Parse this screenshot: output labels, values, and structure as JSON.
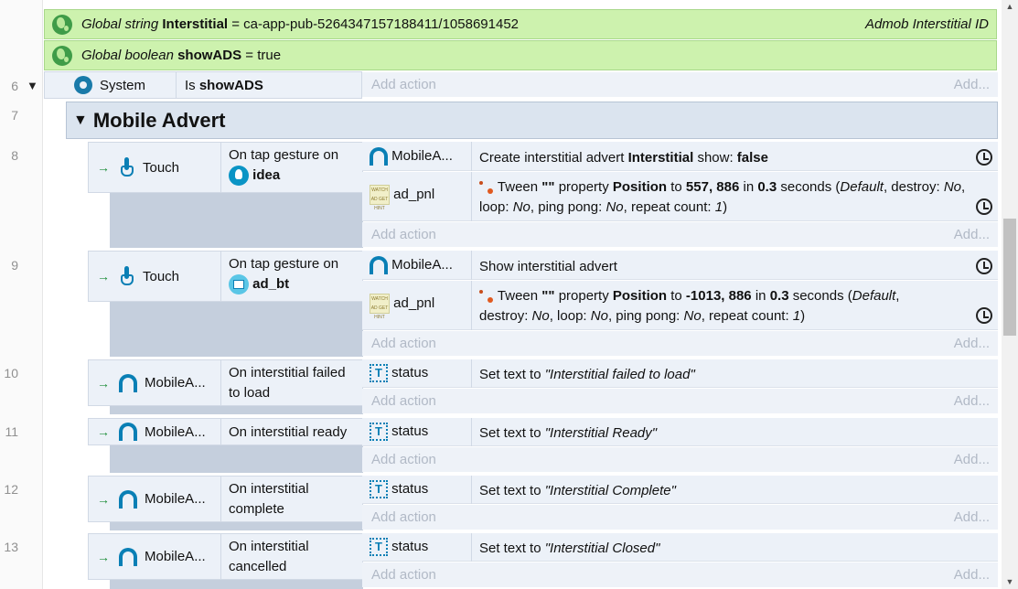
{
  "globals": [
    {
      "type": "Global string",
      "name": "Interstitial",
      "value": "= ca-app-pub-5264347157188411/1058691452",
      "comment": "Admob Interstitial ID"
    },
    {
      "type": "Global boolean",
      "name": "showADS",
      "value": "= true",
      "comment": ""
    }
  ],
  "add_action": "Add action",
  "add_more": "Add...",
  "row6": {
    "num": "6",
    "object": "System",
    "cond_prefix": "Is",
    "cond_bold": "showADS"
  },
  "row7": {
    "num": "7",
    "group": "Mobile Advert"
  },
  "row8": {
    "num": "8",
    "object": "Touch",
    "cond_line1": "On tap gesture on",
    "cond_obj": "idea",
    "a1_obj": "MobileA...",
    "a1_pre": "Create interstitial advert",
    "a1_bold": "Interstitial",
    "a1_mid": "show:",
    "a1_bold2": "false",
    "a2_obj": "ad_pnl",
    "a2_tween": "Tween",
    "a2_q": "\"\"",
    "a2_prop": "property",
    "a2_bold": "Position",
    "a2_to": "to",
    "a2_val": "557, 886",
    "a2_in": "in",
    "a2_sec": "0.3",
    "a2_seconds": "seconds (",
    "a2_default": "Default",
    "a2_destroy": ", destroy:",
    "a2_no": "No",
    "a2_loop": ", loop:",
    "a2_ping": ", ping pong:",
    "a2_rep": ", repeat count:",
    "a2_one": "1",
    "a2_close": ")"
  },
  "row9": {
    "num": "9",
    "object": "Touch",
    "cond_line1": "On tap gesture on",
    "cond_obj": "ad_bt",
    "a1_obj": "MobileA...",
    "a1_text": "Show interstitial advert",
    "a2_obj": "ad_pnl",
    "a2_val": "-1013, 886"
  },
  "row10": {
    "num": "10",
    "object": "MobileA...",
    "cond1": "On interstitial failed",
    "cond2": "to load",
    "a_obj": "status",
    "a_pre": "Set text to",
    "a_val": "\"Interstitial failed to load\""
  },
  "row11": {
    "num": "11",
    "object": "MobileA...",
    "cond1": "On interstitial ready",
    "a_obj": "status",
    "a_pre": "Set text to",
    "a_val": "\"Interstitial Ready\""
  },
  "row12": {
    "num": "12",
    "object": "MobileA...",
    "cond1": "On interstitial",
    "cond2": "complete",
    "a_obj": "status",
    "a_pre": "Set text to",
    "a_val": "\"Interstitial Complete\""
  },
  "row13": {
    "num": "13",
    "object": "MobileA...",
    "cond1": "On interstitial",
    "cond2": "cancelled",
    "a_obj": "status",
    "a_pre": "Set text to",
    "a_val": "\"Interstitial Closed\""
  },
  "sprite_label": "WATCH AD GET HINT"
}
